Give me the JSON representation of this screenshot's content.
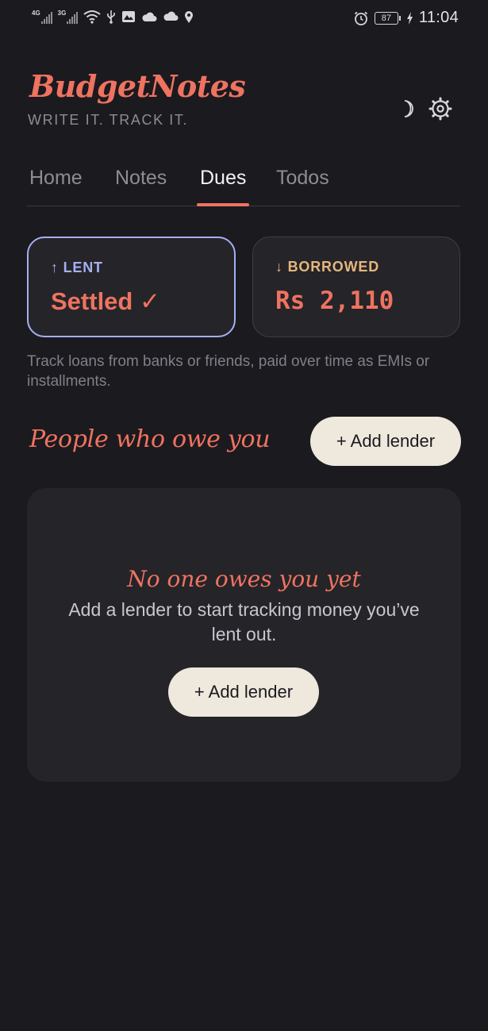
{
  "status_bar": {
    "net1": "4G",
    "net2": "3G",
    "battery": "87",
    "time": "11:04",
    "icons": [
      "wifi-icon",
      "usb-icon",
      "gallery-icon",
      "cloud-icon",
      "cloud-icon",
      "location-icon",
      "alarm-icon",
      "charging-icon"
    ]
  },
  "header": {
    "app_name": "BudgetNotes",
    "tagline": "WRITE IT. TRACK IT.",
    "theme_icon": "moon-icon",
    "settings_icon": "gear-icon"
  },
  "tabs": [
    {
      "label": "Home"
    },
    {
      "label": "Notes"
    },
    {
      "label": "Dues",
      "active": true
    },
    {
      "label": "Todos"
    }
  ],
  "summary": {
    "lent": {
      "label": "↑ LENT",
      "value": "Settled ✓"
    },
    "borrowed": {
      "label": "↓ BORROWED",
      "value": "Rs 2,110"
    }
  },
  "helper_text": "Track loans from banks or friends, paid over time as EMIs or installments.",
  "section": {
    "title": "People who owe you",
    "add_button": "+ Add lender"
  },
  "empty_state": {
    "title": "No one owes you yet",
    "text": "Add a lender to start tracking money you’ve lent out.",
    "button": "+ Add lender"
  },
  "colors": {
    "accent": "#ee7360",
    "lent": "#a6aff1",
    "borrowed": "#e3b77c",
    "background": "#1b1a1f",
    "card": "#252429",
    "button": "#efe8dc"
  }
}
